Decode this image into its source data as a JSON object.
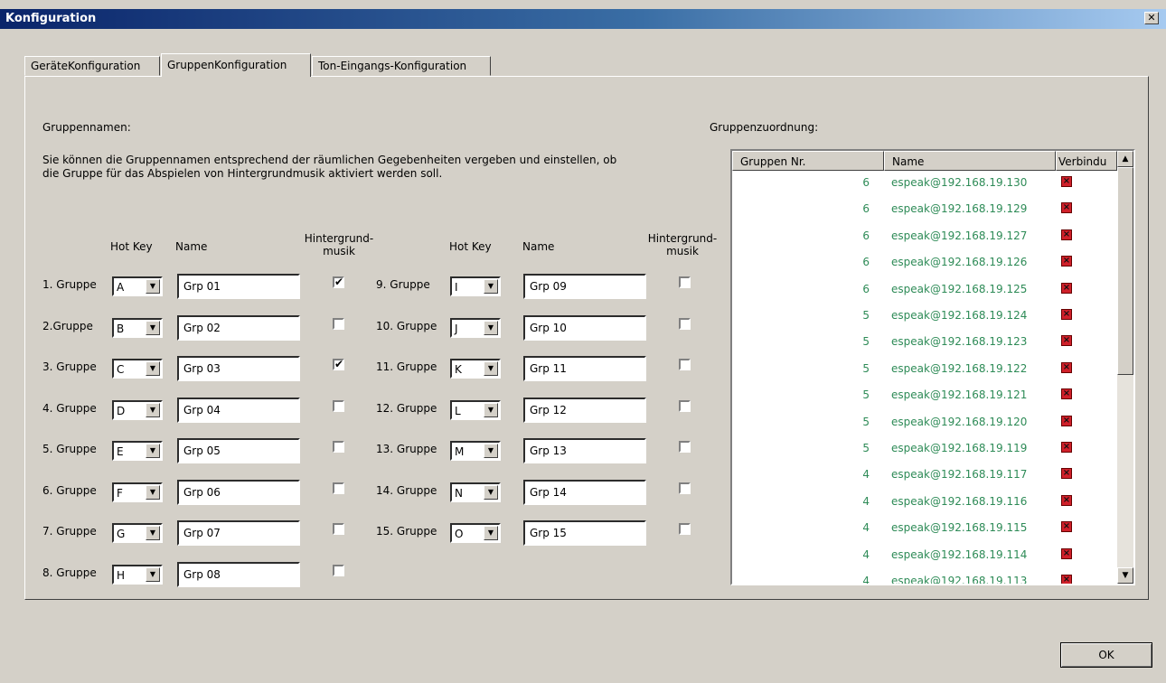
{
  "window": {
    "title": "Konfiguration",
    "close_label": "✕"
  },
  "tabs": [
    {
      "label": "GeräteKonfiguration"
    },
    {
      "label": "GruppenKonfiguration"
    },
    {
      "label": "Ton-Eingangs-Konfiguration"
    }
  ],
  "left": {
    "heading": "Gruppennamen:",
    "description_line1": "Sie können die Gruppennamen entsprechend der räumlichen Gegebenheiten vergeben und einstellen, ob",
    "description_line2": "die Gruppe für das Abspielen von Hintergrundmusik aktiviert werden soll.",
    "col_hotkey": "Hot Key",
    "col_name": "Name",
    "col_bg_line1": "Hintergrund-",
    "col_bg_line2": "musik"
  },
  "groups": [
    {
      "label": "1. Gruppe",
      "hotkey": "A",
      "name": "Grp 01",
      "bg": "✔"
    },
    {
      "label": "2.Gruppe",
      "hotkey": "B",
      "name": "Grp 02",
      "bg": ""
    },
    {
      "label": "3. Gruppe",
      "hotkey": "C",
      "name": "Grp 03",
      "bg": "✔"
    },
    {
      "label": "4. Gruppe",
      "hotkey": "D",
      "name": "Grp 04",
      "bg": ""
    },
    {
      "label": "5. Gruppe",
      "hotkey": "E",
      "name": "Grp 05",
      "bg": ""
    },
    {
      "label": "6. Gruppe",
      "hotkey": "F",
      "name": "Grp 06",
      "bg": ""
    },
    {
      "label": "7. Gruppe",
      "hotkey": "G",
      "name": "Grp 07",
      "bg": ""
    },
    {
      "label": "8. Gruppe",
      "hotkey": "H",
      "name": "Grp 08",
      "bg": ""
    },
    {
      "label": "9. Gruppe",
      "hotkey": "I",
      "name": "Grp 09",
      "bg": ""
    },
    {
      "label": "10. Gruppe",
      "hotkey": "J",
      "name": "Grp 10",
      "bg": ""
    },
    {
      "label": "11. Gruppe",
      "hotkey": "K",
      "name": "Grp 11",
      "bg": ""
    },
    {
      "label": "12. Gruppe",
      "hotkey": "L",
      "name": "Grp 12",
      "bg": ""
    },
    {
      "label": "13. Gruppe",
      "hotkey": "M",
      "name": "Grp 13",
      "bg": ""
    },
    {
      "label": "14. Gruppe",
      "hotkey": "N",
      "name": "Grp 14",
      "bg": ""
    },
    {
      "label": "15. Gruppe",
      "hotkey": "O",
      "name": "Grp 15",
      "bg": ""
    }
  ],
  "right": {
    "heading": "Gruppenzuordnung:",
    "col_nr": "Gruppen Nr.",
    "col_name": "Name",
    "col_conn": "Verbindu",
    "status_icon": "disconnected-icon",
    "rows": [
      {
        "nr": "6",
        "name": "espeak@192.168.19.130"
      },
      {
        "nr": "6",
        "name": "espeak@192.168.19.129"
      },
      {
        "nr": "6",
        "name": "espeak@192.168.19.127"
      },
      {
        "nr": "6",
        "name": "espeak@192.168.19.126"
      },
      {
        "nr": "6",
        "name": "espeak@192.168.19.125"
      },
      {
        "nr": "5",
        "name": "espeak@192.168.19.124"
      },
      {
        "nr": "5",
        "name": "espeak@192.168.19.123"
      },
      {
        "nr": "5",
        "name": "espeak@192.168.19.122"
      },
      {
        "nr": "5",
        "name": "espeak@192.168.19.121"
      },
      {
        "nr": "5",
        "name": "espeak@192.168.19.120"
      },
      {
        "nr": "5",
        "name": "espeak@192.168.19.119"
      },
      {
        "nr": "4",
        "name": "espeak@192.168.19.117"
      },
      {
        "nr": "4",
        "name": "espeak@192.168.19.116"
      },
      {
        "nr": "4",
        "name": "espeak@192.168.19.115"
      },
      {
        "nr": "4",
        "name": "espeak@192.168.19.114"
      },
      {
        "nr": "4",
        "name": "espeak@192.168.19.113"
      }
    ]
  },
  "ok_label": "OK",
  "colors": {
    "title_start": "#0a246a",
    "title_end": "#a6caf0",
    "list_text": "#2e8b57",
    "status_red": "#d0202a"
  }
}
